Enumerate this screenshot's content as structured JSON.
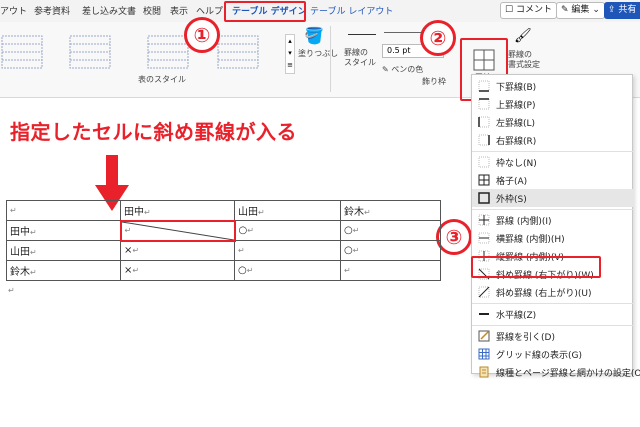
{
  "tabs": [
    "アウト",
    "参考資料",
    "差し込み文書",
    "校閲",
    "表示",
    "ヘルプ",
    "テーブル デザイン",
    "テーブル レイアウト"
  ],
  "top_buttons": {
    "comment": "コメント",
    "edit": "編集",
    "share": "共有"
  },
  "ribbon": {
    "shading_label": "塗りつぶし",
    "table_styles_label": "表のスタイル",
    "border_style_label": "罫線の\nスタイル",
    "pen_width": "0.5 pt",
    "pen_color_label": "ペンの色",
    "borders_group_label": "飾り枠",
    "borders_button_label": "罫線",
    "border_painter_label": "罫線の\n書式設定"
  },
  "heading": "指定したセルに斜め罫線が入る",
  "table": {
    "rows": [
      [
        "",
        "田中",
        "山田",
        "鈴木"
      ],
      [
        "田中",
        "",
        "○",
        "○"
      ],
      [
        "山田",
        "×",
        "",
        "○"
      ],
      [
        "鈴木",
        "×",
        "○",
        ""
      ]
    ]
  },
  "menu": {
    "items": [
      {
        "label": "下罫線(B)",
        "icon": "border-bottom-icon"
      },
      {
        "label": "上罫線(P)",
        "icon": "border-top-icon"
      },
      {
        "label": "左罫線(L)",
        "icon": "border-left-icon"
      },
      {
        "label": "右罫線(R)",
        "icon": "border-right-icon"
      },
      {
        "label": "枠なし(N)",
        "icon": "border-none-icon"
      },
      {
        "label": "格子(A)",
        "icon": "border-all-icon"
      },
      {
        "label": "外枠(S)",
        "icon": "border-outside-icon"
      },
      {
        "label": "罫線 (内側)(I)",
        "icon": "border-inside-icon"
      },
      {
        "label": "横罫線 (内側)(H)",
        "icon": "border-inside-horizontal-icon"
      },
      {
        "label": "縦罫線 (内側)(V)",
        "icon": "border-inside-vertical-icon"
      },
      {
        "label": "斜め罫線 (右下がり)(W)",
        "icon": "diagonal-down-border-icon"
      },
      {
        "label": "斜め罫線 (右上がり)(U)",
        "icon": "diagonal-up-border-icon"
      },
      {
        "label": "水平線(Z)",
        "icon": "horizontal-line-icon"
      },
      {
        "label": "罫線を引く(D)",
        "icon": "draw-table-icon"
      },
      {
        "label": "グリッド線の表示(G)",
        "icon": "view-gridlines-icon"
      },
      {
        "label": "線種とページ罫線と網かけの設定(O)...",
        "icon": "borders-shading-icon"
      }
    ]
  },
  "badges": [
    "①",
    "②",
    "③"
  ],
  "colors": {
    "accent": "#e8212a",
    "brand": "#1f57b8"
  }
}
